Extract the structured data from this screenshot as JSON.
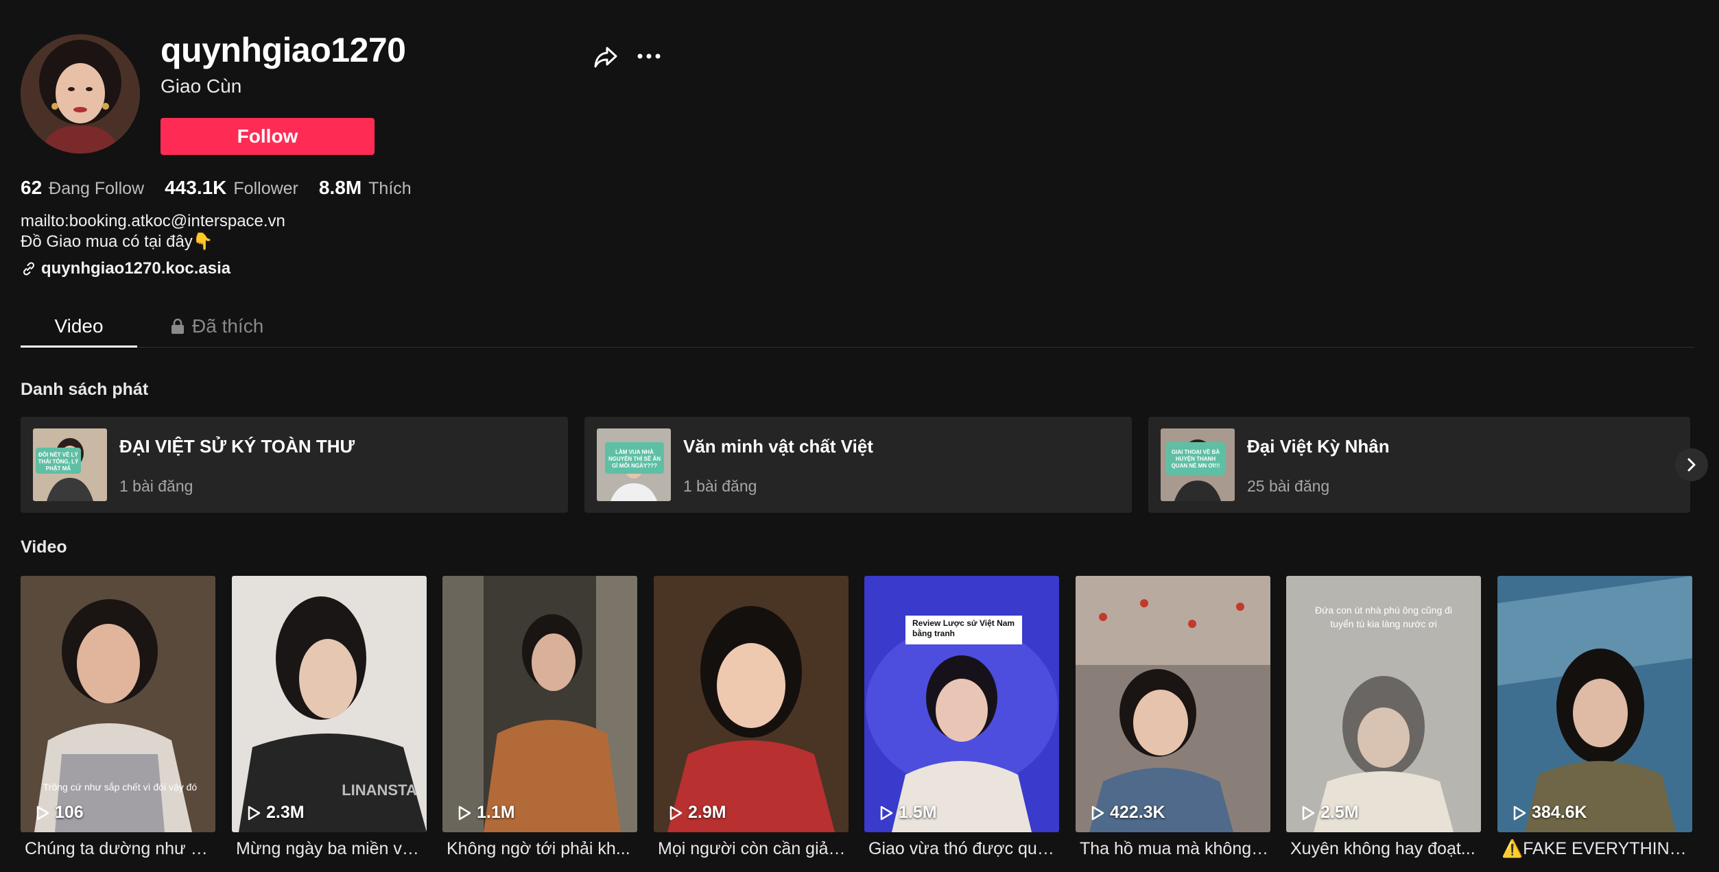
{
  "profile": {
    "username": "quynhgiao1270",
    "nickname": "Giao Cùn",
    "follow_label": "Follow",
    "stats": [
      {
        "value": "62",
        "label": "Đang Follow"
      },
      {
        "value": "443.1K",
        "label": "Follower"
      },
      {
        "value": "8.8M",
        "label": "Thích"
      }
    ],
    "bio_line1": "mailto:booking.atkoc@interspace.vn",
    "bio_line2": "Đồ Giao mua có tại đây👇",
    "link": "quynhgiao1270.koc.asia"
  },
  "icons": {
    "share": "share-icon",
    "more": "more-icon",
    "link": "link-icon",
    "lock": "lock-icon",
    "play": "play-icon",
    "next": "chevron-right-icon"
  },
  "tabs": {
    "video": "Video",
    "liked": "Đã thích"
  },
  "playlists_title": "Danh sách phát",
  "playlists": [
    {
      "title": "ĐẠI VIỆT SỬ KÝ TOÀN THƯ",
      "count": "1 bài đăng",
      "thumb_text": "ĐÔI NÉT VỀ LÝ THÁI TÔNG, LÝ PHẬT MÃ"
    },
    {
      "title": "Văn minh vật chất Việt",
      "count": "1 bài đăng",
      "thumb_text": "LÀM VUA NHÀ NGUYỄN THÌ SẼ ĂN GÌ MỖI NGÀY???"
    },
    {
      "title": "Đại Việt Kỳ Nhân",
      "count": "25 bài đăng",
      "thumb_text": "GIAI THOẠI VỀ BÀ HUYỆN THANH QUAN NÈ MN ƠI!!!"
    }
  ],
  "videos_title": "Video",
  "videos": [
    {
      "views": "106",
      "caption": "Chúng ta dường như đ...",
      "overlay": "Trông cứ như sắp chết vì đói vậy đó"
    },
    {
      "views": "2.3M",
      "caption": "Mừng ngày ba miền về...",
      "overlay": "LINANSTA"
    },
    {
      "views": "1.1M",
      "caption": "Không ngờ tới phải kh...",
      "overlay": ""
    },
    {
      "views": "2.9M",
      "caption": "Mọi người còn cần giải ...",
      "overlay": ""
    },
    {
      "views": "1.5M",
      "caption": "Giao vừa thó được quy...",
      "overlay": "Review Lược sử Việt Nam bằng tranh"
    },
    {
      "views": "422.3K",
      "caption": "Tha hồ mua mà không ...",
      "overlay": ""
    },
    {
      "views": "2.5M",
      "caption": "Xuyên không hay đoạt...",
      "overlay": "Đứa con út nhà phú ông cũng đi tuyển tú kia làng nước ơi"
    },
    {
      "views": "384.6K",
      "caption": "⚠️FAKE EVERYTHING...",
      "overlay": ""
    }
  ],
  "colors": {
    "background": "#121212",
    "follow_button": "#fe2c55",
    "card": "#252525",
    "muted_text": "#a6a6a6"
  }
}
